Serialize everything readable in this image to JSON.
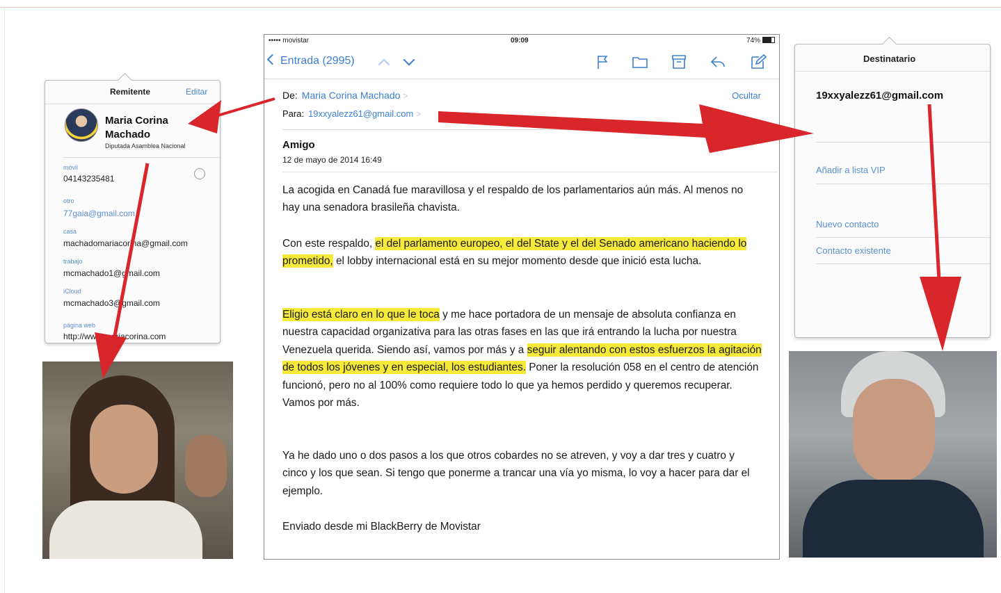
{
  "sender_popover": {
    "title": "Remitente",
    "edit_label": "Editar",
    "name": "Maria Corina Machado",
    "role": "Diputada Asamblea Nacional",
    "fields": [
      {
        "label": "móvil",
        "value": "04143235481"
      },
      {
        "label": "otro",
        "value": "77gaia@gmail.com"
      },
      {
        "label": "casa",
        "value": "machadomariacorina@gmail.com"
      },
      {
        "label": "trabajo",
        "value": "mcmachado1@gmail.com"
      },
      {
        "label": "iCloud",
        "value": "mcmachado3@gmail.com"
      },
      {
        "label": "página web",
        "value": "http://www.mariacorina.com"
      }
    ]
  },
  "mail": {
    "status_bar": {
      "carrier": "••••• movistar",
      "time": "09:09",
      "battery": "74%"
    },
    "back_label": "Entrada (2995)",
    "toolbar_icons": [
      "flag-icon",
      "folder-icon",
      "archive-icon",
      "reply-icon",
      "compose-icon"
    ],
    "from_label": "De:",
    "from_value": "Maria Corina Machado",
    "to_label": "Para:",
    "to_value": "19xxyalezz61@gmail.com",
    "hide_label": "Ocultar",
    "subject": "Amigo",
    "date": "12 de mayo de 2014 16:49",
    "paragraphs": {
      "p1": "La acogida en Canadá fue maravillosa y el respaldo de los parlamentarios aún más. Al menos no hay una senadora brasileña chavista.",
      "p2_a": "Con este respaldo, ",
      "p2_hl": "el del parlamento europeo, el del State y el del Senado americano haciendo lo prometido,",
      "p2_b": " el lobby internacional está en su mejor momento desde que inició esta lucha.",
      "p3_hl1": "Eligio está claro en lo que le toca",
      "p3_a": " y me hace portadora de un mensaje de absoluta confianza en nuestra capacidad organizativa para las otras fases en las que irá entrando la lucha por nuestra Venezuela querida. Siendo así, vamos por más y a ",
      "p3_hl2": "seguir alentando con estos esfuerzos la agitación de todos los jóvenes y en especial, los estudiantes.",
      "p3_b": " Poner la resolución 058 en el centro de atención funcionó, pero no al 100% como requiere todo lo que ya hemos perdido y queremos recuperar. Vamos por más.",
      "p4": "Ya he dado uno o dos pasos a los que otros cobardes no se atreven, y voy a dar tres y cuatro y cinco y los que sean. Si tengo que ponerme a trancar una vía yo misma, lo voy a hacer para dar el ejemplo.",
      "p5": "Enviado desde mi BlackBerry de Movistar"
    },
    "highlight_color": "#f5e93a",
    "link_color": "#3b7fd0"
  },
  "recipient_popover": {
    "title": "Destinatario",
    "email": "19xxyalezz61@gmail.com",
    "actions": [
      "Añadir a lista VIP",
      "Nuevo contacto",
      "Contacto existente"
    ]
  },
  "annotations": {
    "arrow_color": "#d8262b"
  }
}
